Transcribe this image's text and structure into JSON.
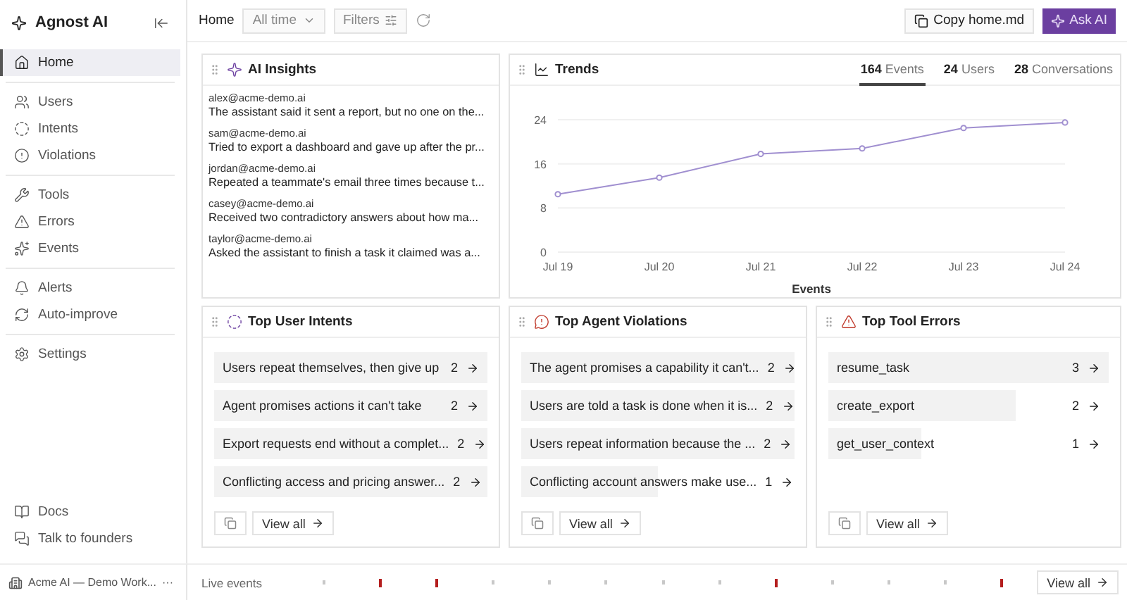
{
  "sidebar": {
    "brand": "Agnost AI",
    "groups": [
      [
        {
          "label": "Home",
          "selected": true
        }
      ],
      [
        {
          "label": "Users",
          "selected": false
        },
        {
          "label": "Intents",
          "selected": false
        },
        {
          "label": "Violations",
          "selected": false
        }
      ],
      [
        {
          "label": "Tools",
          "selected": false
        },
        {
          "label": "Errors",
          "selected": false
        },
        {
          "label": "Events",
          "selected": false
        }
      ],
      [
        {
          "label": "Alerts",
          "selected": false
        },
        {
          "label": "Auto-improve",
          "selected": false
        }
      ],
      [
        {
          "label": "Settings",
          "selected": false
        }
      ]
    ],
    "bottom_links": [
      "Docs",
      "Talk to founders"
    ],
    "workspace": "Acme AI — Demo Work...",
    "workspace_menu": "···"
  },
  "topbar": {
    "breadcrumb": "Home",
    "range": "All time",
    "filters": "Filters",
    "copy_button": "Copy home.md",
    "ask_button": "Ask AI"
  },
  "insights": {
    "title": "AI Insights",
    "items": [
      {
        "user": "alex@acme-demo.ai",
        "text": "The assistant said it sent a report, but no one on the..."
      },
      {
        "user": "sam@acme-demo.ai",
        "text": "Tried to export a dashboard and gave up after the pr..."
      },
      {
        "user": "jordan@acme-demo.ai",
        "text": "Repeated a teammate's email three times because t..."
      },
      {
        "user": "casey@acme-demo.ai",
        "text": "Received two contradictory answers about how ma..."
      },
      {
        "user": "taylor@acme-demo.ai",
        "text": "Asked the assistant to finish a task it claimed was a..."
      }
    ]
  },
  "trends": {
    "title": "Trends",
    "stats": [
      {
        "label": "**164** Events",
        "selected": true
      },
      {
        "label": "**24** Users",
        "selected": false
      },
      {
        "label": "**28** Conversations",
        "selected": false
      }
    ],
    "chart_data": {
      "type": "line",
      "categories": [
        "Jul 19",
        "Jul 20",
        "Jul 21",
        "Jul 22",
        "Jul 23",
        "Jul 24"
      ],
      "series": [
        {
          "name": "Events",
          "color": "#a08fd0",
          "marker": "circle",
          "values": [
            10.5,
            13.5,
            17.8,
            18.8,
            22.5,
            23.5
          ]
        }
      ],
      "ylim": [
        0,
        24
      ],
      "yticks": [
        0,
        8,
        16,
        24
      ]
    }
  },
  "panels": [
    {
      "kind": "intents",
      "title": "Top User Intents",
      "rows": [
        {
          "label": "Users repeat themselves, then give up",
          "count": "2",
          "level": 1
        },
        {
          "label": "Agent promises actions it can't take",
          "count": "2",
          "level": 1
        },
        {
          "label": "Export requests end without a complet...",
          "count": "2",
          "level": 1
        },
        {
          "label": "Conflicting access and pricing answer...",
          "count": "2",
          "level": 1
        }
      ],
      "view_all": "View all"
    },
    {
      "kind": "violations",
      "title": "Top Agent Violations",
      "rows": [
        {
          "label": "The agent promises a capability it can't...",
          "count": "2",
          "level": 1
        },
        {
          "label": "Users are told a task is done when it is...",
          "count": "2",
          "level": 1
        },
        {
          "label": "Users repeat information because the ...",
          "count": "2",
          "level": 1
        },
        {
          "label": "Conflicting account answers make use...",
          "count": "1",
          "level": 0.5
        }
      ],
      "view_all": "View all"
    },
    {
      "kind": "errors",
      "title": "Top Tool Errors",
      "rows": [
        {
          "label": "resume_task",
          "count": "3",
          "level": 1
        },
        {
          "label": "create_export",
          "count": "2",
          "level": 0.67
        },
        {
          "label": "get_user_context",
          "count": "1",
          "level": 0.33
        }
      ],
      "view_all": "View all"
    }
  ],
  "live_events": {
    "label": "Live events",
    "ticks": [
      {
        "color": "#c8c8c8"
      },
      {
        "color": "#b41e1e"
      },
      {
        "color": "#b41e1e"
      },
      {
        "color": "#c8c8c8"
      },
      {
        "color": "#c8c8c8"
      },
      {
        "color": "#c8c8c8"
      },
      {
        "color": "#c8c8c8"
      },
      {
        "color": "#c8c8c8"
      },
      {
        "color": "#b41e1e"
      },
      {
        "color": "#c8c8c8"
      },
      {
        "color": "#c8c8c8"
      },
      {
        "color": "#c8c8c8"
      },
      {
        "color": "#b41e1e"
      }
    ],
    "view_all": "View all"
  }
}
